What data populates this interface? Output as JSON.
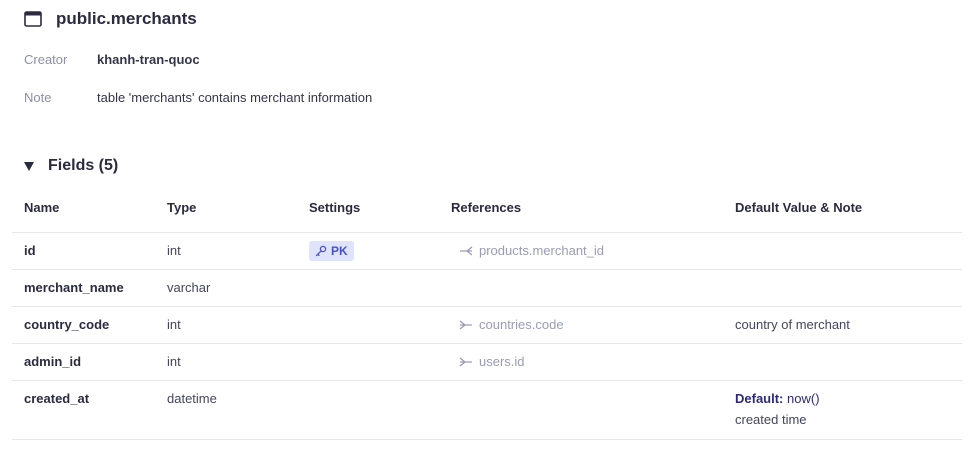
{
  "table_name": "public.merchants",
  "meta": {
    "creator_label": "Creator",
    "creator_value": "khanh-tran-quoc",
    "note_label": "Note",
    "note_value": "table 'merchants' contains merchant information"
  },
  "fields_title": "Fields (5)",
  "columns": [
    "Name",
    "Type",
    "Settings",
    "References",
    "Default Value & Note"
  ],
  "rows": [
    {
      "name": "id",
      "type": "int",
      "pk": "PK",
      "ref": "products.merchant_id",
      "ref_icon": "one-to-many-icon",
      "default": ""
    },
    {
      "name": "merchant_name",
      "type": "varchar",
      "pk": "",
      "ref": "",
      "default": ""
    },
    {
      "name": "country_code",
      "type": "int",
      "pk": "",
      "ref": "countries.code",
      "ref_icon": "many-to-one-icon",
      "default": "country of merchant"
    },
    {
      "name": "admin_id",
      "type": "int",
      "pk": "",
      "ref": "users.id",
      "ref_icon": "many-to-one-icon",
      "default": ""
    },
    {
      "name": "created_at",
      "type": "datetime",
      "pk": "",
      "ref": "",
      "default_label": "Default:",
      "default_value": "now()",
      "note": "created time"
    }
  ]
}
